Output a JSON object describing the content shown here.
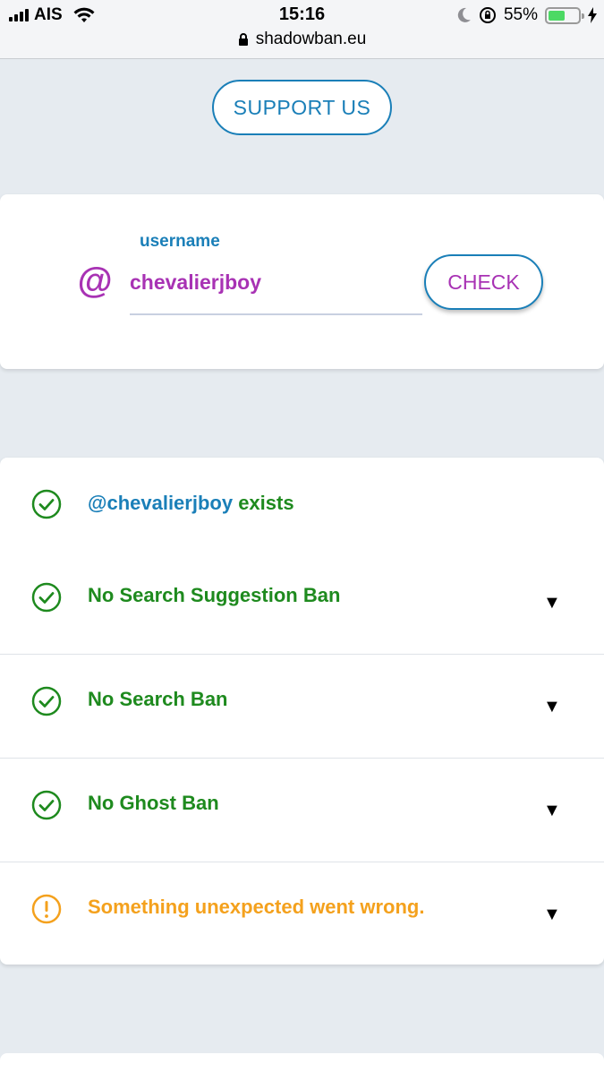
{
  "status_bar": {
    "carrier": "AIS",
    "time": "15:16",
    "battery_percent": "55%",
    "battery_level": 0.55,
    "battery_color": "#4cd964"
  },
  "browser": {
    "url": "shadowban.eu"
  },
  "support": {
    "label": "SUPPORT US"
  },
  "search": {
    "at_symbol": "@",
    "field_label": "username",
    "username_value": "chevalierjboy",
    "check_label": "CHECK"
  },
  "results": [
    {
      "icon": "check-circle-icon",
      "handle": "@chevalierjboy",
      "text": " exists",
      "color": "#1e8a1e",
      "expandable": false
    },
    {
      "icon": "check-circle-icon",
      "text": "No Search Suggestion Ban",
      "color": "#1e8a1e",
      "expandable": true
    },
    {
      "icon": "check-circle-icon",
      "text": "No Search Ban",
      "color": "#1e8a1e",
      "expandable": true
    },
    {
      "icon": "check-circle-icon",
      "text": "No Ghost Ban",
      "color": "#1e8a1e",
      "expandable": true
    },
    {
      "icon": "warning-circle-icon",
      "text": "Something unexpected went wrong.",
      "color": "#f4a11d",
      "expandable": true
    }
  ],
  "caret_glyph": "▼",
  "colors": {
    "accent_blue": "#1a7fb8",
    "accent_purple": "#a832b4",
    "success_green": "#1e8a1e",
    "warning_orange": "#f4a11d"
  }
}
